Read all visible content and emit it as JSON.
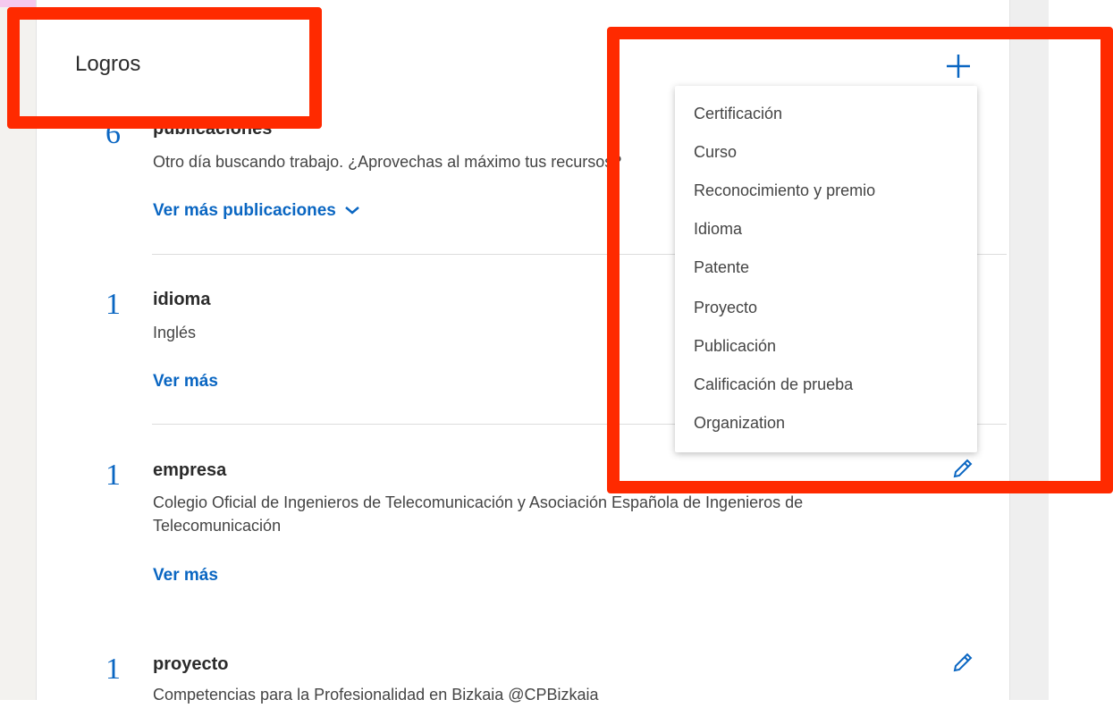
{
  "card": {
    "title": "Logros"
  },
  "add_icon": "plus-icon",
  "sections": [
    {
      "count": "6",
      "title": "publicaciones",
      "description": "Otro día buscando trabajo. ¿Aprovechas al máximo tus recursos?",
      "link": "Ver más publicaciones"
    },
    {
      "count": "1",
      "title": "idioma",
      "description": "Inglés",
      "link": "Ver más"
    },
    {
      "count": "1",
      "title": "empresa",
      "description": "Colegio Oficial de Ingenieros de Telecomunicación y Asociación Española de Ingenieros de Telecomunicación",
      "link": "Ver más"
    },
    {
      "count": "1",
      "title": "proyecto",
      "description": "Competencias para la Profesionalidad en Bizkaia @CPBizkaia"
    }
  ],
  "dropdown": {
    "items": [
      "Certificación",
      "Curso",
      "Reconocimiento y premio",
      "Idioma",
      "Patente",
      "Proyecto",
      "Publicación",
      "Calificación de prueba",
      "Organization"
    ]
  },
  "colors": {
    "accent": "#0a66c2",
    "highlight": "#ff2a00"
  }
}
